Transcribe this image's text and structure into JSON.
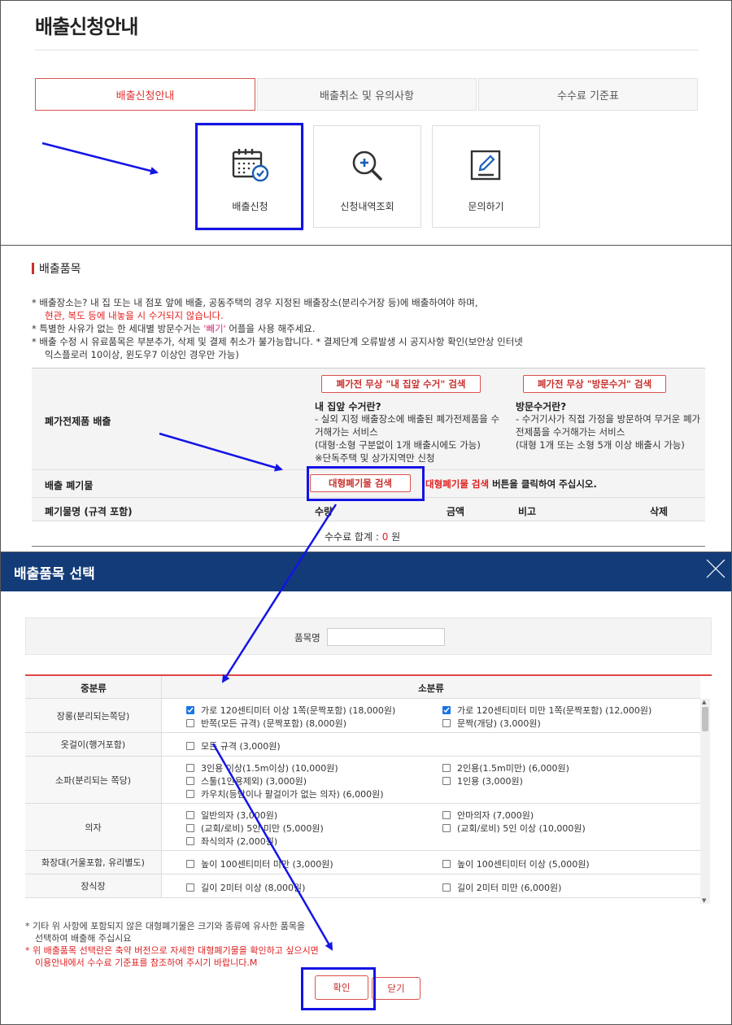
{
  "section1": {
    "title": "배출신청안내",
    "tabs": [
      {
        "label": "배출신청안내",
        "active": true
      },
      {
        "label": "배출취소 및 유의사항",
        "active": false
      },
      {
        "label": "수수료 기준표",
        "active": false
      }
    ],
    "services": [
      {
        "label": "배출신청",
        "icon": "calendar-check-icon"
      },
      {
        "label": "신청내역조회",
        "icon": "magnifier-plus-icon"
      },
      {
        "label": "문의하기",
        "icon": "edit-pencil-icon"
      }
    ]
  },
  "section2": {
    "heading": "배출품목",
    "notes": {
      "n1": "* 배출장소는? 내 집 또는 내 점포 앞에 배출, 공동주택의 경우 지정된 배출장소(분리수거장 등)에 배출하여야 하며,",
      "n1_red": "현관, 복도 등에 내놓을 시 수거되지 않습니다.",
      "n2_pre": "* 특별한 사유가 없는 한 세대별 방문수거는",
      "n2_app": "'빼기'",
      "n2_post": "어플을 사용 해주세요.",
      "n3": "* 배출 수정 시 유료품목은 부분추가, 삭제 및 결제 취소가 불가능합니다. * 결제단계 오류발생 시 공지사항 확인(보안상 인터넷",
      "n3_cont": "익스플로러 10이상, 윈도우7 이상인 경우만 가능)"
    },
    "appliance": {
      "label": "폐가전제품 배출",
      "home_btn": "폐가전 무상 \"내 집앞 수거\" 검색",
      "home_title": "내 집앞 수거란?",
      "home_desc": "- 실외 지정 배출장소에 배출된 폐가전제품을 수거해가는 서비스",
      "home_desc2": "(대형·소형 구분없이 1개 배출시에도 가능)",
      "home_desc3": "※단독주택 및 상가지역만 신청",
      "visit_btn": "폐가전 무상 \"방문수거\" 검색",
      "visit_title": "방문수거란?",
      "visit_desc": "- 수거기사가 직접 가정을 방문하여 무거운 폐가전제품을 수거해가는 서비스",
      "visit_desc2": "(대형 1개 또는 소형 5개 이상 배출시 가능)"
    },
    "waste": {
      "label": "배출 폐기물",
      "btn": "대형폐기물 검색",
      "hint_red": "대형폐기물 검색",
      "hint": "버튼을 클릭하여 주십시오."
    },
    "columns": [
      "폐기물명 (규격 포함)",
      "수량",
      "금액",
      "비고",
      "삭제"
    ],
    "sum_label": "수수료 합계 :",
    "sum_value": "0",
    "sum_unit": "원"
  },
  "modal": {
    "title": "배출품목 선택",
    "search_label": "품목명",
    "search_value": "",
    "col_main": "중분류",
    "col_sub": "소분류",
    "rows": [
      {
        "cat": "장롱(분리되는쪽당)",
        "items": [
          {
            "label": "가로 120센티미터 이상 1쪽(문짝포함) (18,000원)",
            "checked": true
          },
          {
            "label": "반쪽(모든 규격) (문짝포함) (8,000원)",
            "checked": false
          },
          {
            "label": "가로 120센티미터 미만 1쪽(문짝포함) (12,000원)",
            "checked": true
          },
          {
            "label": "문짝(개당) (3,000원)",
            "checked": false
          }
        ]
      },
      {
        "cat": "옷걸이(행거포함)",
        "items": [
          {
            "label": "모든 규격 (3,000원)",
            "checked": false
          }
        ]
      },
      {
        "cat": "소파(분리되는 쪽당)",
        "items": [
          {
            "label": "3인용 이상(1.5m이상) (10,000원)",
            "checked": false
          },
          {
            "label": "스툴(1인용제외) (3,000원)",
            "checked": false
          },
          {
            "label": "카우치(등받이나 팔걸이가 없는 의자) (6,000원)",
            "checked": false
          },
          {
            "label": "2인용(1.5m미만) (6,000원)",
            "checked": false
          },
          {
            "label": "1인용 (3,000원)",
            "checked": false
          }
        ]
      },
      {
        "cat": "의자",
        "items": [
          {
            "label": "일반의자 (3,000원)",
            "checked": false
          },
          {
            "label": "(교회/로비) 5인 미만 (5,000원)",
            "checked": false
          },
          {
            "label": "좌식의자 (2,000원)",
            "checked": false
          },
          {
            "label": "안마의자 (7,000원)",
            "checked": false
          },
          {
            "label": "(교회/로비) 5인 이상 (10,000원)",
            "checked": false
          }
        ]
      },
      {
        "cat": "화장대(거울포함, 유리별도)",
        "items": [
          {
            "label": "높이 100센티미터 미만 (3,000원)",
            "checked": false
          },
          {
            "label": "높이 100센티미터 이상 (5,000원)",
            "checked": false
          }
        ]
      },
      {
        "cat": "장식장",
        "items": [
          {
            "label": "길이 2미터 이상 (8,000원)",
            "checked": false
          },
          {
            "label": "길이 2미터 미만 (6,000원)",
            "checked": false
          }
        ]
      }
    ],
    "note1": "* 기타 위 사항에 포함되지 않은 대형폐기물은 크기와 종류에 유사한 품목을",
    "note1b": "선택하여 배출해 주십시요",
    "note2": "* 위 배출품목 선택란은 축약 버전으로 자세한 대형폐기물을 확인하고 싶으시면",
    "note2b": "이용안내에서 수수료 기준표를 참조하여 주시기 바랍니다.M",
    "confirm": "확인",
    "close": "닫기"
  },
  "colors": {
    "accent_red": "#d9534f",
    "modal_header": "#123b78",
    "annotation_blue": "#1414e6",
    "checkbox_blue": "#1a73e8"
  }
}
